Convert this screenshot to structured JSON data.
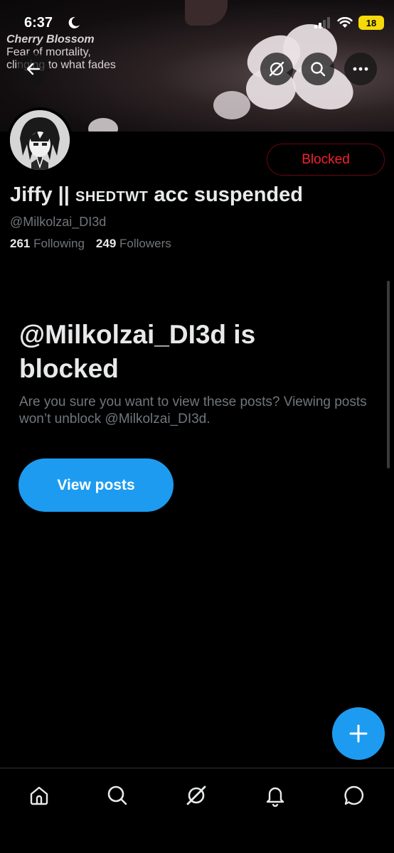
{
  "status_bar": {
    "time": "6:37",
    "battery_level": "18"
  },
  "banner": {
    "caption_title": "Cherry Blossom",
    "caption_line1": "Fear of mortality,",
    "caption_line2": "clinging to what fades"
  },
  "header_buttons": {
    "back_icon": "arrow-left-icon",
    "grok_icon": "grok-icon",
    "search_icon": "search-icon",
    "more_icon": "more-icon"
  },
  "profile": {
    "display_name_main": "Jiffy || ",
    "display_name_caps": "SHEDTWT",
    "display_name_tail": " acc suspended",
    "handle": "@Milkolzai_DI3d",
    "following_count": "261",
    "following_label": "Following",
    "followers_count": "249",
    "followers_label": "Followers",
    "blocked_label": "Blocked"
  },
  "blocked_notice": {
    "title": "@Milkolzai_DI3d is blocked",
    "body": "Are you sure you want to view these posts? Viewing posts won’t unblock @Milkolzai_DI3d.",
    "view_button_label": "View posts"
  },
  "tabbar": {
    "items": [
      {
        "name": "home",
        "icon": "home-icon"
      },
      {
        "name": "search",
        "icon": "search-icon"
      },
      {
        "name": "grok",
        "icon": "grok-icon"
      },
      {
        "name": "notifications",
        "icon": "bell-icon"
      },
      {
        "name": "messages",
        "icon": "chat-bubble-icon"
      }
    ]
  },
  "colors": {
    "accent": "#1d9bf0",
    "blocked_red": "#f4212e",
    "muted_text": "#71767b",
    "primary_text": "#e7e9ea"
  }
}
